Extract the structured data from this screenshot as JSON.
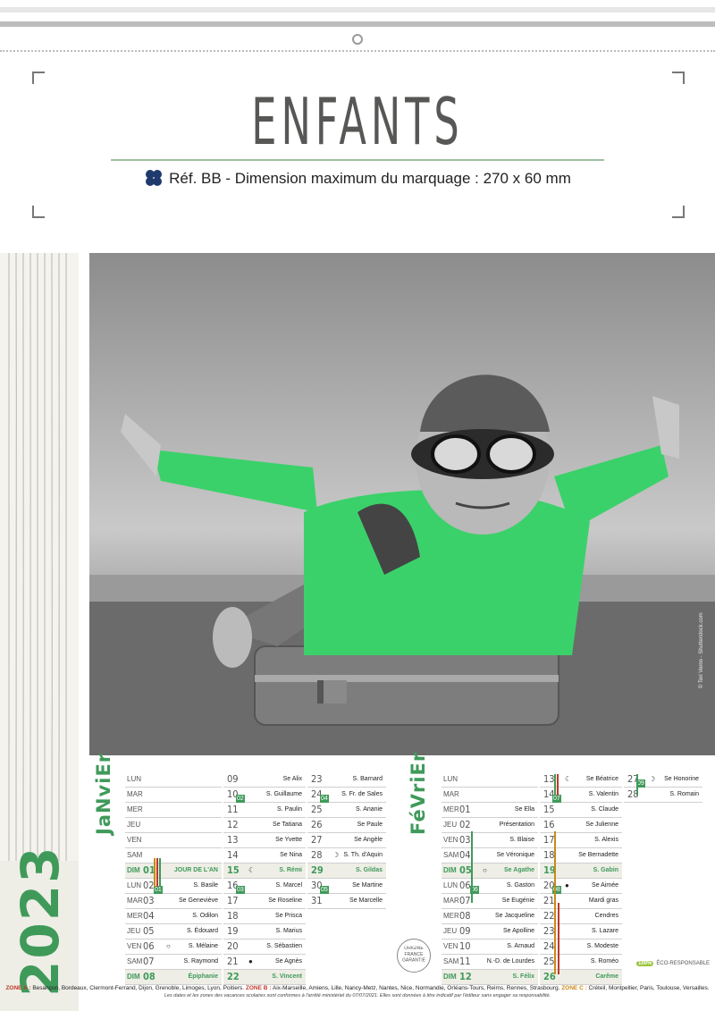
{
  "header": {
    "title": "ENFANTS",
    "ref_text": "Réf. BB - Dimension maximum du marquage : 270 x 60 mm",
    "clover_icon": "clover-icon",
    "accent": "#3f9a5a"
  },
  "year": "2023",
  "photo_credit": "© Teri Verno - Shutterstock.com",
  "january": {
    "name": "JaNviEr",
    "col1": [
      {
        "wd": "LUN",
        "d": "",
        "s": ""
      },
      {
        "wd": "MAR",
        "d": "",
        "s": ""
      },
      {
        "wd": "MER",
        "d": "",
        "s": ""
      },
      {
        "wd": "JEU",
        "d": "",
        "s": ""
      },
      {
        "wd": "VEN",
        "d": "",
        "s": ""
      },
      {
        "wd": "SAM",
        "d": "",
        "s": ""
      },
      {
        "wd": "DIM",
        "d": "01",
        "s": "JOUR DE L'AN",
        "sun": true
      },
      {
        "wd": "LUN",
        "d": "02",
        "s": "S. Basile",
        "wk": "01"
      },
      {
        "wd": "MAR",
        "d": "03",
        "s": "Se Geneviève"
      },
      {
        "wd": "MER",
        "d": "04",
        "s": "S. Odilon"
      },
      {
        "wd": "JEU",
        "d": "05",
        "s": "S. Édouard"
      },
      {
        "wd": "VEN",
        "d": "06",
        "s": "S. Mélaine",
        "moon": "○"
      },
      {
        "wd": "SAM",
        "d": "07",
        "s": "S. Raymond"
      },
      {
        "wd": "DIM",
        "d": "08",
        "s": "Épiphanie",
        "sun": true
      }
    ],
    "col2": [
      {
        "d": "09",
        "s": "Se Alix"
      },
      {
        "d": "10",
        "s": "S. Guillaume",
        "wk": "02"
      },
      {
        "d": "11",
        "s": "S. Paulin"
      },
      {
        "d": "12",
        "s": "Se Tatiana"
      },
      {
        "d": "13",
        "s": "Se Yvette"
      },
      {
        "d": "14",
        "s": "Se Nina"
      },
      {
        "d": "15",
        "s": "S. Rémi",
        "moon": "☾",
        "sun": true
      },
      {
        "d": "16",
        "s": "S. Marcel",
        "wk": "03"
      },
      {
        "d": "17",
        "s": "Se Roseline"
      },
      {
        "d": "18",
        "s": "Se Prisca"
      },
      {
        "d": "19",
        "s": "S. Marius"
      },
      {
        "d": "20",
        "s": "S. Sébastien"
      },
      {
        "d": "21",
        "s": "Se Agnès",
        "moon": "●"
      },
      {
        "d": "22",
        "s": "S. Vincent",
        "sun": true
      }
    ],
    "col3": [
      {
        "d": "23",
        "s": "S. Barnard"
      },
      {
        "d": "24",
        "s": "S. Fr. de Sales",
        "wk": "04"
      },
      {
        "d": "25",
        "s": "S. Ananie"
      },
      {
        "d": "26",
        "s": "Se Paule"
      },
      {
        "d": "27",
        "s": "Se Angèle"
      },
      {
        "d": "28",
        "s": "S. Th. d'Aquin",
        "moon": "☽"
      },
      {
        "d": "29",
        "s": "S. Gildas",
        "sun": true
      },
      {
        "d": "30",
        "s": "Se Martine",
        "wk": "05"
      },
      {
        "d": "31",
        "s": "Se Marcelle"
      }
    ]
  },
  "february": {
    "name": "FéVriEr",
    "col1": [
      {
        "wd": "LUN",
        "d": "",
        "s": ""
      },
      {
        "wd": "MAR",
        "d": "",
        "s": ""
      },
      {
        "wd": "MER",
        "d": "01",
        "s": "Se Ella"
      },
      {
        "wd": "JEU",
        "d": "02",
        "s": "Présentation"
      },
      {
        "wd": "VEN",
        "d": "03",
        "s": "S. Blaise"
      },
      {
        "wd": "SAM",
        "d": "04",
        "s": "Se Véronique"
      },
      {
        "wd": "DIM",
        "d": "05",
        "s": "Se Agathe",
        "moon": "○",
        "sun": true
      },
      {
        "wd": "LUN",
        "d": "06",
        "s": "S. Gaston",
        "wk": "06"
      },
      {
        "wd": "MAR",
        "d": "07",
        "s": "Se Eugénie"
      },
      {
        "wd": "MER",
        "d": "08",
        "s": "Se Jacqueline"
      },
      {
        "wd": "JEU",
        "d": "09",
        "s": "Se Apolline"
      },
      {
        "wd": "VEN",
        "d": "10",
        "s": "S. Arnaud"
      },
      {
        "wd": "SAM",
        "d": "11",
        "s": "N.-D. de Lourdes"
      },
      {
        "wd": "DIM",
        "d": "12",
        "s": "S. Félix",
        "sun": true
      }
    ],
    "col2": [
      {
        "d": "13",
        "s": "Se Béatrice",
        "moon": "☾"
      },
      {
        "d": "14",
        "s": "S. Valentin",
        "wk": "07"
      },
      {
        "d": "15",
        "s": "S. Claude"
      },
      {
        "d": "16",
        "s": "Se Julienne"
      },
      {
        "d": "17",
        "s": "S. Alexis"
      },
      {
        "d": "18",
        "s": "Se Bernadette"
      },
      {
        "d": "19",
        "s": "S. Gabin",
        "sun": true
      },
      {
        "d": "20",
        "s": "Se Aimée",
        "moon": "●",
        "wk": "08"
      },
      {
        "d": "21",
        "s": "Mardi gras"
      },
      {
        "d": "22",
        "s": "Cendres"
      },
      {
        "d": "23",
        "s": "S. Lazare"
      },
      {
        "d": "24",
        "s": "S. Modeste"
      },
      {
        "d": "25",
        "s": "S. Roméo"
      },
      {
        "d": "26",
        "s": "Carême",
        "sun": true
      }
    ],
    "col3": [
      {
        "d": "27",
        "s": "Se Honorine",
        "moon": "☽",
        "wk": "09"
      },
      {
        "d": "28",
        "s": "S. Romain"
      }
    ]
  },
  "seal_text": "ORIGINE FRANCE GARANTIE",
  "eco_badge": "100%",
  "eco_text": "ÉCO-RESPONSABLE",
  "footer": {
    "zone_a_label": "ZONE A :",
    "zone_a": "Besançon, Bordeaux, Clermont-Ferrand, Dijon, Grenoble, Limoges, Lyon, Poitiers.",
    "zone_b_label": "ZONE B :",
    "zone_b": "Aix-Marseille, Amiens, Lille, Nancy-Metz, Nantes, Nice, Normandie, Orléans-Tours, Reims, Rennes, Strasbourg.",
    "zone_c_label": "ZONE C :",
    "zone_c": "Créteil, Montpellier, Paris, Toulouse, Versailles.",
    "note": "Les dates et les zones des vacances scolaires sont conformes à l'arrêté ministériel du 07/07/2021. Elles sont données à titre indicatif par l'éditeur sans engager sa responsabilité."
  }
}
